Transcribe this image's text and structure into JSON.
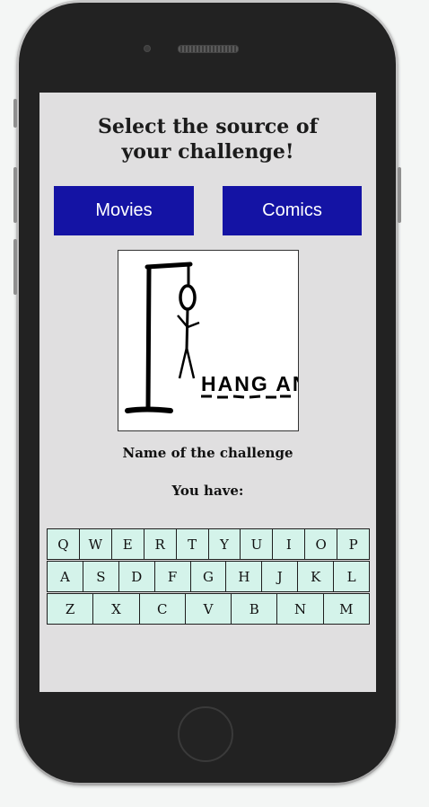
{
  "screen": {
    "heading": "Select the source of your challenge!",
    "buttons": {
      "movies_label": "Movies",
      "comics_label": "Comics"
    },
    "image": {
      "logo_text": "HANG AN",
      "icon": "hangman-icon"
    },
    "challenge_name": "Name of the challenge",
    "attempts_label": "You have:"
  },
  "keyboard": {
    "rows": [
      [
        "Q",
        "W",
        "E",
        "R",
        "T",
        "Y",
        "U",
        "I",
        "O",
        "P"
      ],
      [
        "A",
        "S",
        "D",
        "F",
        "G",
        "H",
        "J",
        "K",
        "L"
      ],
      [
        "Z",
        "X",
        "C",
        "V",
        "B",
        "N",
        "M"
      ]
    ]
  },
  "colors": {
    "button_bg": "#1413a4",
    "key_bg": "#d4f3ea",
    "screen_bg": "#e0dfe0"
  }
}
